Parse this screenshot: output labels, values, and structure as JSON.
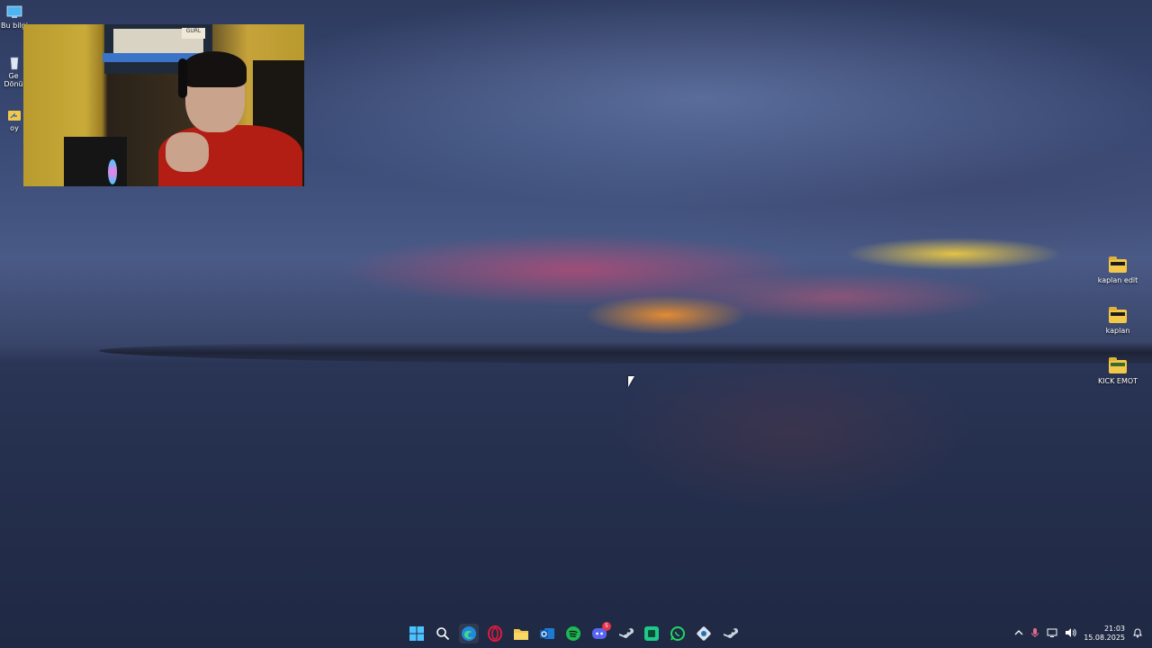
{
  "desktop": {
    "left_icons": [
      {
        "label": "Bu bilgi",
        "icon": "monitor-icon"
      },
      {
        "label": "Ge Dönü",
        "icon": "recycle-bin-icon"
      },
      {
        "label": "oy",
        "icon": "shortcut-folder-icon"
      }
    ],
    "right_icons": [
      {
        "label": "kaplan edit",
        "icon": "folder-icon"
      },
      {
        "label": "kaplan",
        "icon": "folder-icon"
      },
      {
        "label": "KICK EMOT",
        "icon": "folder-icon"
      }
    ]
  },
  "webcam": {
    "sign_text": "GURL"
  },
  "taskbar": {
    "apps": [
      {
        "name": "start",
        "icon": "windows-start-icon"
      },
      {
        "name": "search",
        "icon": "search-icon"
      },
      {
        "name": "edge",
        "icon": "edge-browser-icon"
      },
      {
        "name": "opera",
        "icon": "opera-gx-icon"
      },
      {
        "name": "file-explorer",
        "icon": "folder-icon"
      },
      {
        "name": "outlook",
        "icon": "outlook-icon"
      },
      {
        "name": "spotify",
        "icon": "spotify-icon"
      },
      {
        "name": "discord",
        "icon": "discord-icon",
        "badge": "5"
      },
      {
        "name": "steam",
        "icon": "steam-icon"
      },
      {
        "name": "app-green",
        "icon": "green-app-icon"
      },
      {
        "name": "whatsapp",
        "icon": "whatsapp-icon"
      },
      {
        "name": "app-gear",
        "icon": "gear-app-icon"
      },
      {
        "name": "steam-2",
        "icon": "steam-icon"
      }
    ],
    "tray": {
      "time": "21:03",
      "date": "15.08.2025"
    }
  },
  "colors": {
    "folder": "#f1c84a",
    "spotify": "#1db954",
    "opera": "#e21b3c",
    "discord": "#5865f2",
    "whatsapp": "#25d366"
  }
}
